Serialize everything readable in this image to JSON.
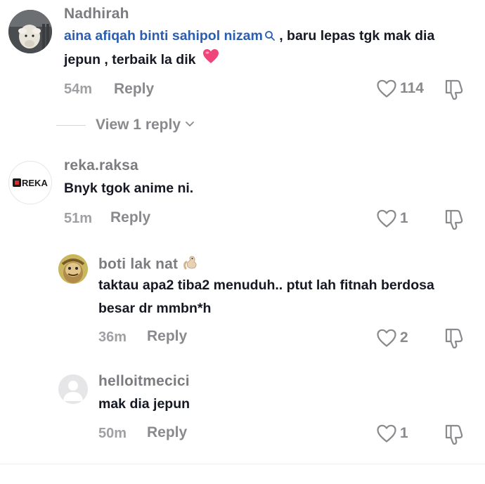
{
  "comments": [
    {
      "username": "Nadhirah",
      "mention": "aina afiqah binti sahipol nizam",
      "text_line1": ", baru lepas tgk mak dia",
      "text_line2": "jepun , terbaik la dik",
      "time": "54m",
      "reply_label": "Reply",
      "likes": "114"
    },
    {
      "username": "reka.raksa",
      "avatar_label": "REKA",
      "text": "Bnyk tgok anime ni.",
      "time": "51m",
      "reply_label": "Reply",
      "likes": "1"
    }
  ],
  "view_replies_label": "View 1 reply",
  "replies": [
    {
      "username": "boti lak nat",
      "text_line1": "taktau apa2 tiba2 menuduh.. ptut lah fitnah berdosa",
      "text_line2": "besar dr mmbn*h",
      "time": "36m",
      "reply_label": "Reply",
      "likes": "2"
    },
    {
      "username": "helloitmecici",
      "text": "mak dia jepun",
      "time": "50m",
      "reply_label": "Reply",
      "likes": "1"
    }
  ],
  "icons": {
    "like": "heart-outline-icon",
    "dislike": "thumbs-down-outline-icon",
    "heart_emoji": "pink-heart-emoji",
    "search": "search-icon",
    "chevron": "chevron-down-icon"
  },
  "colors": {
    "mention": "#2b5db0",
    "muted": "#8a8a8e",
    "text": "#161823",
    "heart_emoji": "#f0457a"
  }
}
